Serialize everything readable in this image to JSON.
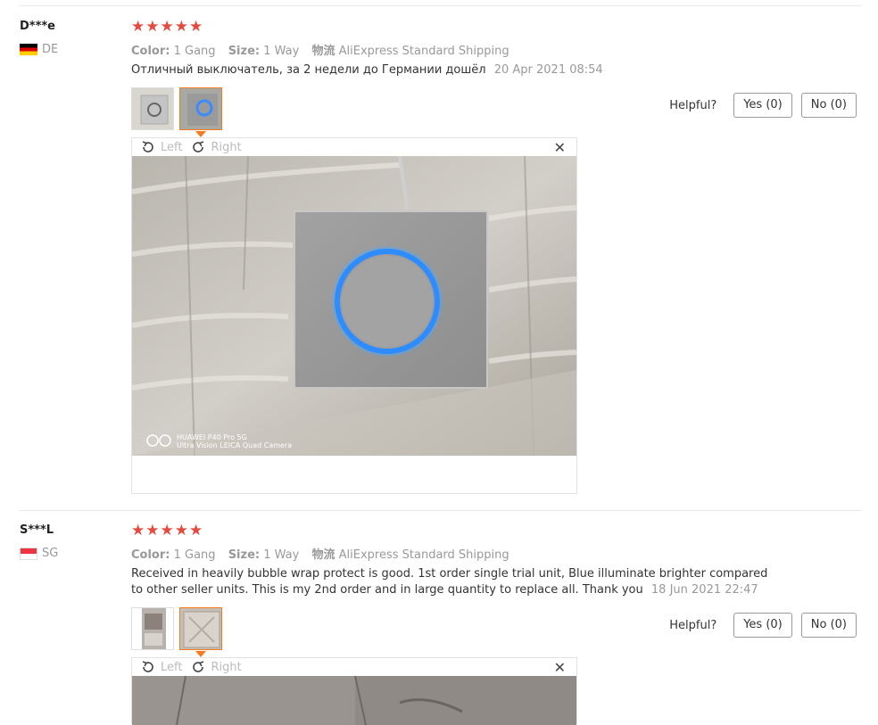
{
  "reviews": [
    {
      "user": "D***e",
      "country": "DE",
      "stars": "★★★★★",
      "color_label": "Color:",
      "color_value": "1 Gang",
      "size_label": "Size:",
      "size_value": "1 Way",
      "ship_label": "物流",
      "ship_value": "AliExpress Standard Shipping",
      "text": "Отличный выключатель, за 2 недели до Германии дошёл",
      "date": "20 Apr 2021 08:54",
      "helpful_label": "Helpful?",
      "yes_label": "Yes (0)",
      "no_label": "No (0)",
      "viewer": {
        "left_label": "Left",
        "right_label": "Right",
        "close_label": "✕"
      },
      "photo_caption_line1": "HUAWEI P40 Pro 5G",
      "photo_caption_line2": "Ultra Vision LEICA Quad Camera"
    },
    {
      "user": "S***L",
      "country": "SG",
      "stars": "★★★★★",
      "color_label": "Color:",
      "color_value": "1 Gang",
      "size_label": "Size:",
      "size_value": "1 Way",
      "ship_label": "物流",
      "ship_value": "AliExpress Standard Shipping",
      "text": "Received in heavily bubble wrap protect is good. 1st order single trial unit, Blue illuminate brighter compared to other seller units. This is my 2nd order and in large quantity to replace all. Thank you",
      "date": "18 Jun 2021 22:47",
      "helpful_label": "Helpful?",
      "yes_label": "Yes (0)",
      "no_label": "No (0)",
      "viewer": {
        "left_label": "Left",
        "right_label": "Right",
        "close_label": "✕"
      }
    }
  ],
  "colors": {
    "star": "#e44b3f",
    "accent": "#f47b20",
    "ring": "#2f8cff"
  }
}
